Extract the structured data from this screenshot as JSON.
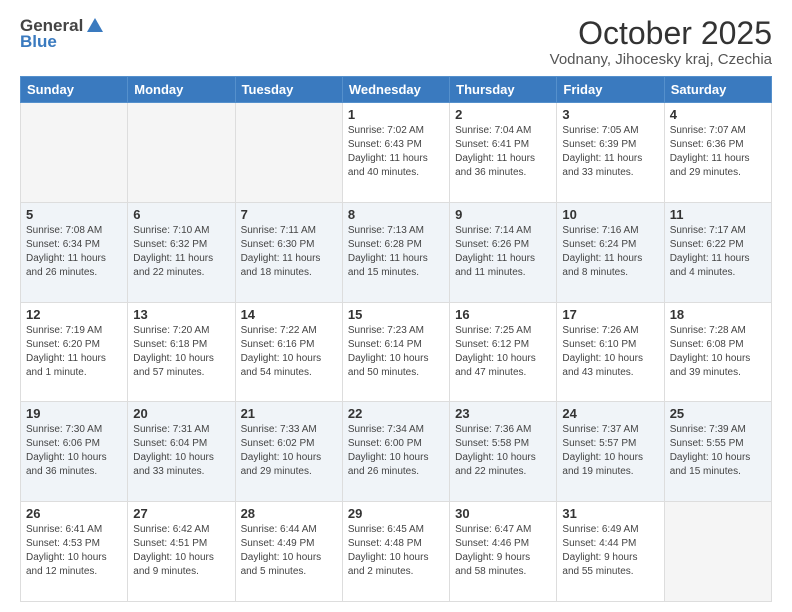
{
  "header": {
    "logo_general": "General",
    "logo_blue": "Blue",
    "month_title": "October 2025",
    "location": "Vodnany, Jihocesky kraj, Czechia"
  },
  "weekdays": [
    "Sunday",
    "Monday",
    "Tuesday",
    "Wednesday",
    "Thursday",
    "Friday",
    "Saturday"
  ],
  "weeks": [
    [
      {
        "day": "",
        "info": ""
      },
      {
        "day": "",
        "info": ""
      },
      {
        "day": "",
        "info": ""
      },
      {
        "day": "1",
        "info": "Sunrise: 7:02 AM\nSunset: 6:43 PM\nDaylight: 11 hours\nand 40 minutes."
      },
      {
        "day": "2",
        "info": "Sunrise: 7:04 AM\nSunset: 6:41 PM\nDaylight: 11 hours\nand 36 minutes."
      },
      {
        "day": "3",
        "info": "Sunrise: 7:05 AM\nSunset: 6:39 PM\nDaylight: 11 hours\nand 33 minutes."
      },
      {
        "day": "4",
        "info": "Sunrise: 7:07 AM\nSunset: 6:36 PM\nDaylight: 11 hours\nand 29 minutes."
      }
    ],
    [
      {
        "day": "5",
        "info": "Sunrise: 7:08 AM\nSunset: 6:34 PM\nDaylight: 11 hours\nand 26 minutes."
      },
      {
        "day": "6",
        "info": "Sunrise: 7:10 AM\nSunset: 6:32 PM\nDaylight: 11 hours\nand 22 minutes."
      },
      {
        "day": "7",
        "info": "Sunrise: 7:11 AM\nSunset: 6:30 PM\nDaylight: 11 hours\nand 18 minutes."
      },
      {
        "day": "8",
        "info": "Sunrise: 7:13 AM\nSunset: 6:28 PM\nDaylight: 11 hours\nand 15 minutes."
      },
      {
        "day": "9",
        "info": "Sunrise: 7:14 AM\nSunset: 6:26 PM\nDaylight: 11 hours\nand 11 minutes."
      },
      {
        "day": "10",
        "info": "Sunrise: 7:16 AM\nSunset: 6:24 PM\nDaylight: 11 hours\nand 8 minutes."
      },
      {
        "day": "11",
        "info": "Sunrise: 7:17 AM\nSunset: 6:22 PM\nDaylight: 11 hours\nand 4 minutes."
      }
    ],
    [
      {
        "day": "12",
        "info": "Sunrise: 7:19 AM\nSunset: 6:20 PM\nDaylight: 11 hours\nand 1 minute."
      },
      {
        "day": "13",
        "info": "Sunrise: 7:20 AM\nSunset: 6:18 PM\nDaylight: 10 hours\nand 57 minutes."
      },
      {
        "day": "14",
        "info": "Sunrise: 7:22 AM\nSunset: 6:16 PM\nDaylight: 10 hours\nand 54 minutes."
      },
      {
        "day": "15",
        "info": "Sunrise: 7:23 AM\nSunset: 6:14 PM\nDaylight: 10 hours\nand 50 minutes."
      },
      {
        "day": "16",
        "info": "Sunrise: 7:25 AM\nSunset: 6:12 PM\nDaylight: 10 hours\nand 47 minutes."
      },
      {
        "day": "17",
        "info": "Sunrise: 7:26 AM\nSunset: 6:10 PM\nDaylight: 10 hours\nand 43 minutes."
      },
      {
        "day": "18",
        "info": "Sunrise: 7:28 AM\nSunset: 6:08 PM\nDaylight: 10 hours\nand 39 minutes."
      }
    ],
    [
      {
        "day": "19",
        "info": "Sunrise: 7:30 AM\nSunset: 6:06 PM\nDaylight: 10 hours\nand 36 minutes."
      },
      {
        "day": "20",
        "info": "Sunrise: 7:31 AM\nSunset: 6:04 PM\nDaylight: 10 hours\nand 33 minutes."
      },
      {
        "day": "21",
        "info": "Sunrise: 7:33 AM\nSunset: 6:02 PM\nDaylight: 10 hours\nand 29 minutes."
      },
      {
        "day": "22",
        "info": "Sunrise: 7:34 AM\nSunset: 6:00 PM\nDaylight: 10 hours\nand 26 minutes."
      },
      {
        "day": "23",
        "info": "Sunrise: 7:36 AM\nSunset: 5:58 PM\nDaylight: 10 hours\nand 22 minutes."
      },
      {
        "day": "24",
        "info": "Sunrise: 7:37 AM\nSunset: 5:57 PM\nDaylight: 10 hours\nand 19 minutes."
      },
      {
        "day": "25",
        "info": "Sunrise: 7:39 AM\nSunset: 5:55 PM\nDaylight: 10 hours\nand 15 minutes."
      }
    ],
    [
      {
        "day": "26",
        "info": "Sunrise: 6:41 AM\nSunset: 4:53 PM\nDaylight: 10 hours\nand 12 minutes."
      },
      {
        "day": "27",
        "info": "Sunrise: 6:42 AM\nSunset: 4:51 PM\nDaylight: 10 hours\nand 9 minutes."
      },
      {
        "day": "28",
        "info": "Sunrise: 6:44 AM\nSunset: 4:49 PM\nDaylight: 10 hours\nand 5 minutes."
      },
      {
        "day": "29",
        "info": "Sunrise: 6:45 AM\nSunset: 4:48 PM\nDaylight: 10 hours\nand 2 minutes."
      },
      {
        "day": "30",
        "info": "Sunrise: 6:47 AM\nSunset: 4:46 PM\nDaylight: 9 hours\nand 58 minutes."
      },
      {
        "day": "31",
        "info": "Sunrise: 6:49 AM\nSunset: 4:44 PM\nDaylight: 9 hours\nand 55 minutes."
      },
      {
        "day": "",
        "info": ""
      }
    ]
  ]
}
